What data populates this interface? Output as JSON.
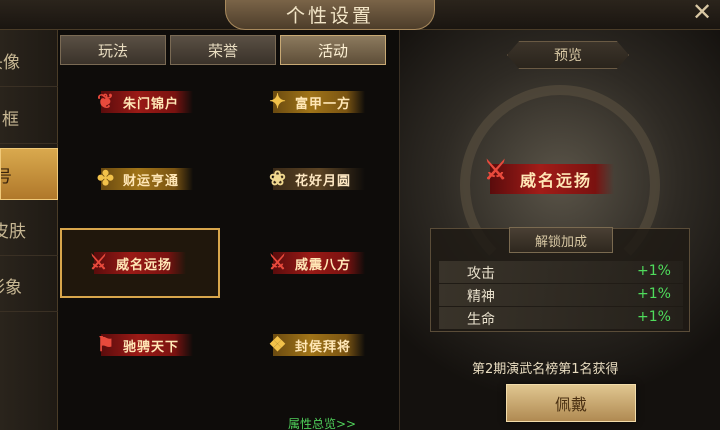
{
  "window": {
    "title": "个性设置",
    "close_icon": "✕"
  },
  "categories": [
    {
      "label": "头像",
      "active": false
    },
    {
      "label": "框",
      "active": false
    },
    {
      "label": "号",
      "active": true
    },
    {
      "label": "皮肤",
      "active": false
    },
    {
      "label": "形象",
      "active": false
    }
  ],
  "tabs": [
    {
      "label": "玩法",
      "active": false
    },
    {
      "label": "荣誉",
      "active": false
    },
    {
      "label": "活动",
      "active": true
    }
  ],
  "titles": [
    {
      "text": "朱门锦户",
      "style": "red",
      "selected": false
    },
    {
      "text": "富甲一方",
      "style": "gold",
      "selected": false
    },
    {
      "text": "财运亨通",
      "style": "gold",
      "selected": false
    },
    {
      "text": "花好月圆",
      "style": "pink",
      "selected": false
    },
    {
      "text": "威名远扬",
      "style": "red",
      "selected": true
    },
    {
      "text": "威震八方",
      "style": "red",
      "selected": false
    },
    {
      "text": "驰骋天下",
      "style": "red",
      "selected": false
    },
    {
      "text": "封侯拜将",
      "style": "gold",
      "selected": false
    }
  ],
  "attr_link": "属性总览>>",
  "preview": {
    "label": "预览",
    "title": "威名远扬",
    "bonus_header": "解锁加成",
    "bonuses": [
      {
        "name": "攻击",
        "value": "+1%"
      },
      {
        "name": "精神",
        "value": "+1%"
      },
      {
        "name": "生命",
        "value": "+1%"
      }
    ],
    "obtain": "第2期演武名榜第1名获得",
    "wear_button": "佩戴"
  },
  "colors": {
    "accent_gold": "#d8a64c",
    "bonus_green": "#4fdc5c",
    "link_green": "#4fcf5a",
    "banner_red": "#9a1a16"
  }
}
